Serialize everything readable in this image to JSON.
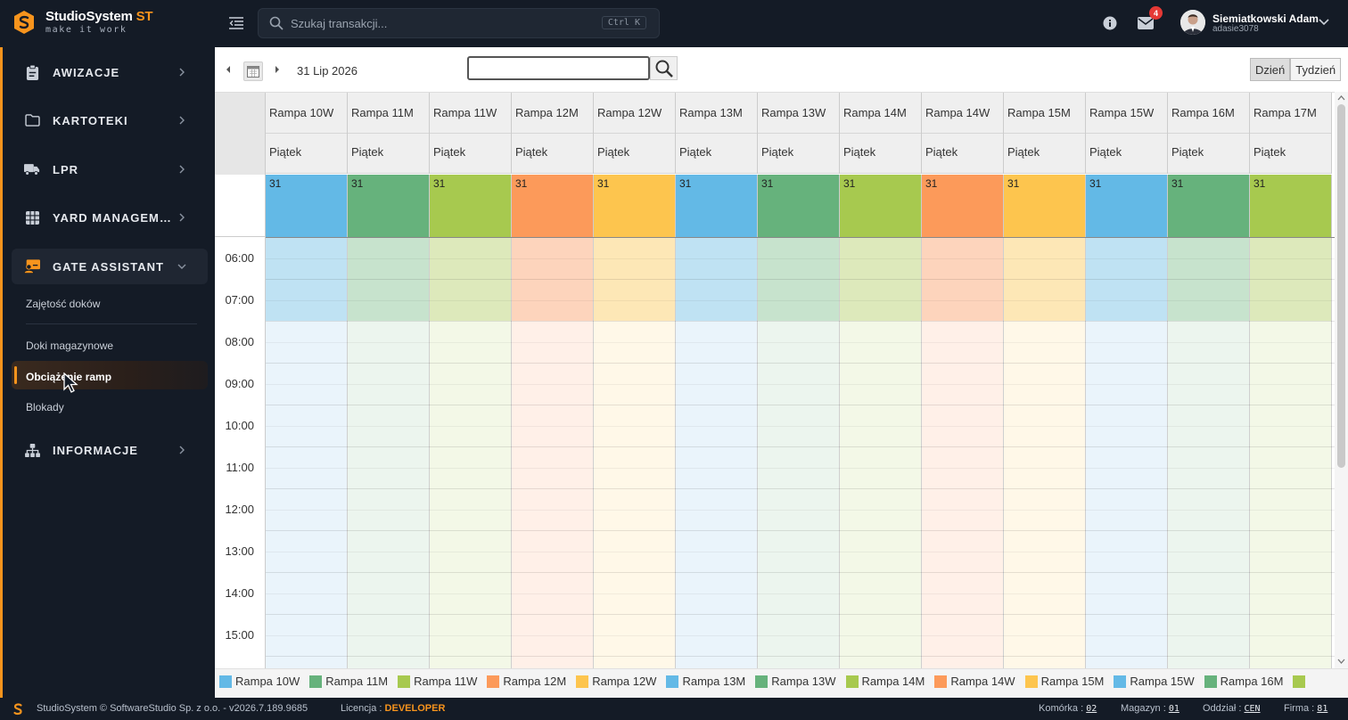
{
  "app": {
    "brand": "StudioSystem",
    "brand_suffix": "ST",
    "tagline": "make it work"
  },
  "topbar": {
    "search_placeholder": "Szukaj transakcji...",
    "search_shortcut": "Ctrl K",
    "notifications_count": "4",
    "user_name": "Siemiatkowski Adam",
    "user_login": "adasie3078"
  },
  "sidebar": {
    "items": [
      {
        "label": "AWIZACJE",
        "icon": "clipboard-icon"
      },
      {
        "label": "KARTOTEKI",
        "icon": "folder-icon"
      },
      {
        "label": "LPR",
        "icon": "truck-icon"
      },
      {
        "label": "YARD MANAGEMENT",
        "icon": "grid-icon"
      },
      {
        "label": "GATE ASSISTANT",
        "icon": "monitor-user-icon"
      },
      {
        "label": "INFORMACJE",
        "icon": "sitemap-icon"
      }
    ],
    "subitems": [
      "Zajętość doków",
      "Doki magazynowe",
      "Obciążenie ramp",
      "Blokady"
    ],
    "active_subitem": "Obciążenie ramp"
  },
  "toolbar": {
    "date": "31 Lip 2026",
    "view_day": "Dzień",
    "view_week": "Tydzień",
    "active_view": "Dzień"
  },
  "calendar": {
    "day_name": "Piątek",
    "day_number": "31",
    "columns": [
      {
        "name": "Rampa 10W",
        "color": "#63b9e6",
        "light": "#bfe2f3",
        "pale": "#eaf4fb"
      },
      {
        "name": "Rampa 11M",
        "color": "#66b27c",
        "light": "#c7e3cd",
        "pale": "#ecf5ee"
      },
      {
        "name": "Rampa 11W",
        "color": "#a7c94f",
        "light": "#dde9bb",
        "pale": "#f3f8e7"
      },
      {
        "name": "Rampa 12M",
        "color": "#fc9a5a",
        "light": "#fdd4bc",
        "pale": "#fff0e8"
      },
      {
        "name": "Rampa 12W",
        "color": "#fdc54e",
        "light": "#fde7b6",
        "pale": "#fff8e8"
      },
      {
        "name": "Rampa 13M",
        "color": "#63b9e6",
        "light": "#bfe2f3",
        "pale": "#eaf4fb"
      },
      {
        "name": "Rampa 13W",
        "color": "#66b27c",
        "light": "#c7e3cd",
        "pale": "#ecf5ee"
      },
      {
        "name": "Rampa 14M",
        "color": "#a7c94f",
        "light": "#dde9bb",
        "pale": "#f3f8e7"
      },
      {
        "name": "Rampa 14W",
        "color": "#fc9a5a",
        "light": "#fdd4bc",
        "pale": "#fff0e8"
      },
      {
        "name": "Rampa 15M",
        "color": "#fdc54e",
        "light": "#fde7b6",
        "pale": "#fff8e8"
      },
      {
        "name": "Rampa 15W",
        "color": "#63b9e6",
        "light": "#bfe2f3",
        "pale": "#eaf4fb"
      },
      {
        "name": "Rampa 16M",
        "color": "#66b27c",
        "light": "#c7e3cd",
        "pale": "#ecf5ee"
      },
      {
        "name": "Rampa 17M",
        "color": "#a7c94f",
        "light": "#dde9bb",
        "pale": "#f3f8e7"
      }
    ],
    "hours": [
      "06:00",
      "07:00",
      "08:00",
      "09:00",
      "10:00",
      "11:00",
      "12:00",
      "13:00",
      "14:00",
      "15:00"
    ]
  },
  "legend": {
    "items": [
      {
        "name": "Rampa 10W",
        "color": "#63b9e6"
      },
      {
        "name": "Rampa 11M",
        "color": "#66b27c"
      },
      {
        "name": "Rampa 11W",
        "color": "#a7c94f"
      },
      {
        "name": "Rampa 12M",
        "color": "#fc9a5a"
      },
      {
        "name": "Rampa 12W",
        "color": "#fdc54e"
      },
      {
        "name": "Rampa 13M",
        "color": "#63b9e6"
      },
      {
        "name": "Rampa 13W",
        "color": "#66b27c"
      },
      {
        "name": "Rampa 14M",
        "color": "#a7c94f"
      },
      {
        "name": "Rampa 14W",
        "color": "#fc9a5a"
      },
      {
        "name": "Rampa 15M",
        "color": "#fdc54e"
      },
      {
        "name": "Rampa 15W",
        "color": "#63b9e6"
      },
      {
        "name": "Rampa 16M",
        "color": "#66b27c"
      },
      {
        "name": "",
        "color": "#a7c94f"
      }
    ]
  },
  "footer": {
    "copyright": "StudioSystem © SoftwareStudio Sp. z o.o. - v2026.7.189.9685",
    "license_label": "Licencja :",
    "license_value": "DEVELOPER",
    "komorka_label": "Komórka :",
    "komorka_value": "02",
    "magazyn_label": "Magazyn :",
    "magazyn_value": "01",
    "oddzial_label": "Oddział :",
    "oddzial_value": "CEN",
    "firma_label": "Firma :",
    "firma_value": "81"
  },
  "theme": {
    "accent": "#f7941d",
    "dark": "#141b26"
  }
}
